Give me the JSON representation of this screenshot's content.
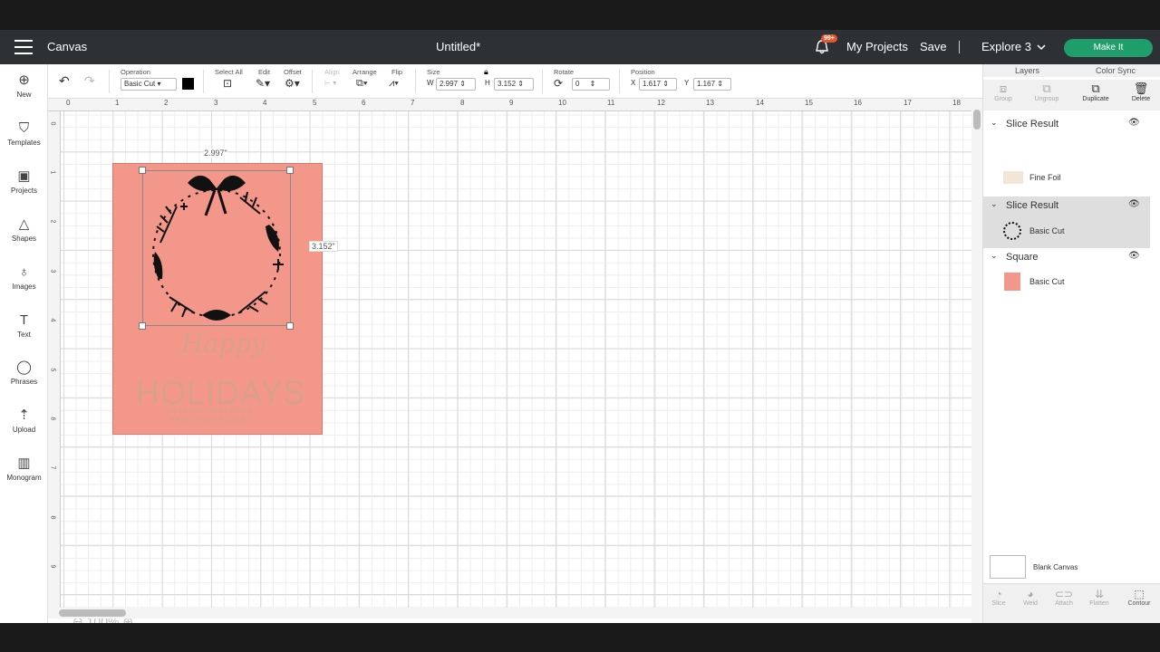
{
  "topbar": {
    "canvas_label": "Canvas",
    "doc_title": "Untitled*",
    "notif_badge": "99+",
    "my_projects": "My Projects",
    "save": "Save",
    "machine": "Explore 3",
    "make_it": "Make It"
  },
  "leftbar": [
    "New",
    "Templates",
    "Projects",
    "Shapes",
    "Images",
    "Text",
    "Phrases",
    "Upload",
    "Monogram"
  ],
  "toolbar": {
    "operation_label": "Operation",
    "operation_value": "Basic Cut",
    "select_all": "Select All",
    "edit": "Edit",
    "offset": "Offset",
    "align": "Align",
    "arrange": "Arrange",
    "flip": "Flip",
    "size_label": "Size",
    "w_label": "W",
    "w_value": "2.997",
    "h_label": "H",
    "h_value": "3.152",
    "rotate_label": "Rotate",
    "rotate_value": "0",
    "position_label": "Position",
    "x_label": "X",
    "x_value": "1.617",
    "y_label": "Y",
    "y_value": "1.167"
  },
  "ruler": {
    "top": [
      "0",
      "1",
      "2",
      "3",
      "4",
      "5",
      "6",
      "7",
      "8",
      "9",
      "10",
      "11",
      "12",
      "13",
      "14",
      "15",
      "16",
      "17",
      "18"
    ],
    "left": [
      "0",
      "1",
      "2",
      "3",
      "4",
      "5",
      "6",
      "7",
      "8",
      "9"
    ]
  },
  "canvas": {
    "width_dim": "2.997\"",
    "height_dim": "3.152\"",
    "foil_happy": "Happy",
    "foil_holidays": "HOLIDAYS",
    "foil_line1": "SEASONS GREETINGS",
    "foil_line2": "FROM THE HOLDENS",
    "card_color": "#f4978b",
    "zoom": "100%"
  },
  "rightpanel": {
    "tabs": [
      "Layers",
      "Color Sync"
    ],
    "tools": [
      "Group",
      "Ungroup",
      "Duplicate",
      "Delete"
    ],
    "layers": [
      {
        "name": "Slice Result",
        "item": "Fine Foil"
      },
      {
        "name": "Slice Result",
        "item": "Basic Cut"
      },
      {
        "name": "Square",
        "item": "Basic Cut"
      }
    ],
    "blank_canvas": "Blank Canvas",
    "bottom_tools": [
      "Slice",
      "Weld",
      "Attach",
      "Flatten",
      "Contour"
    ]
  }
}
